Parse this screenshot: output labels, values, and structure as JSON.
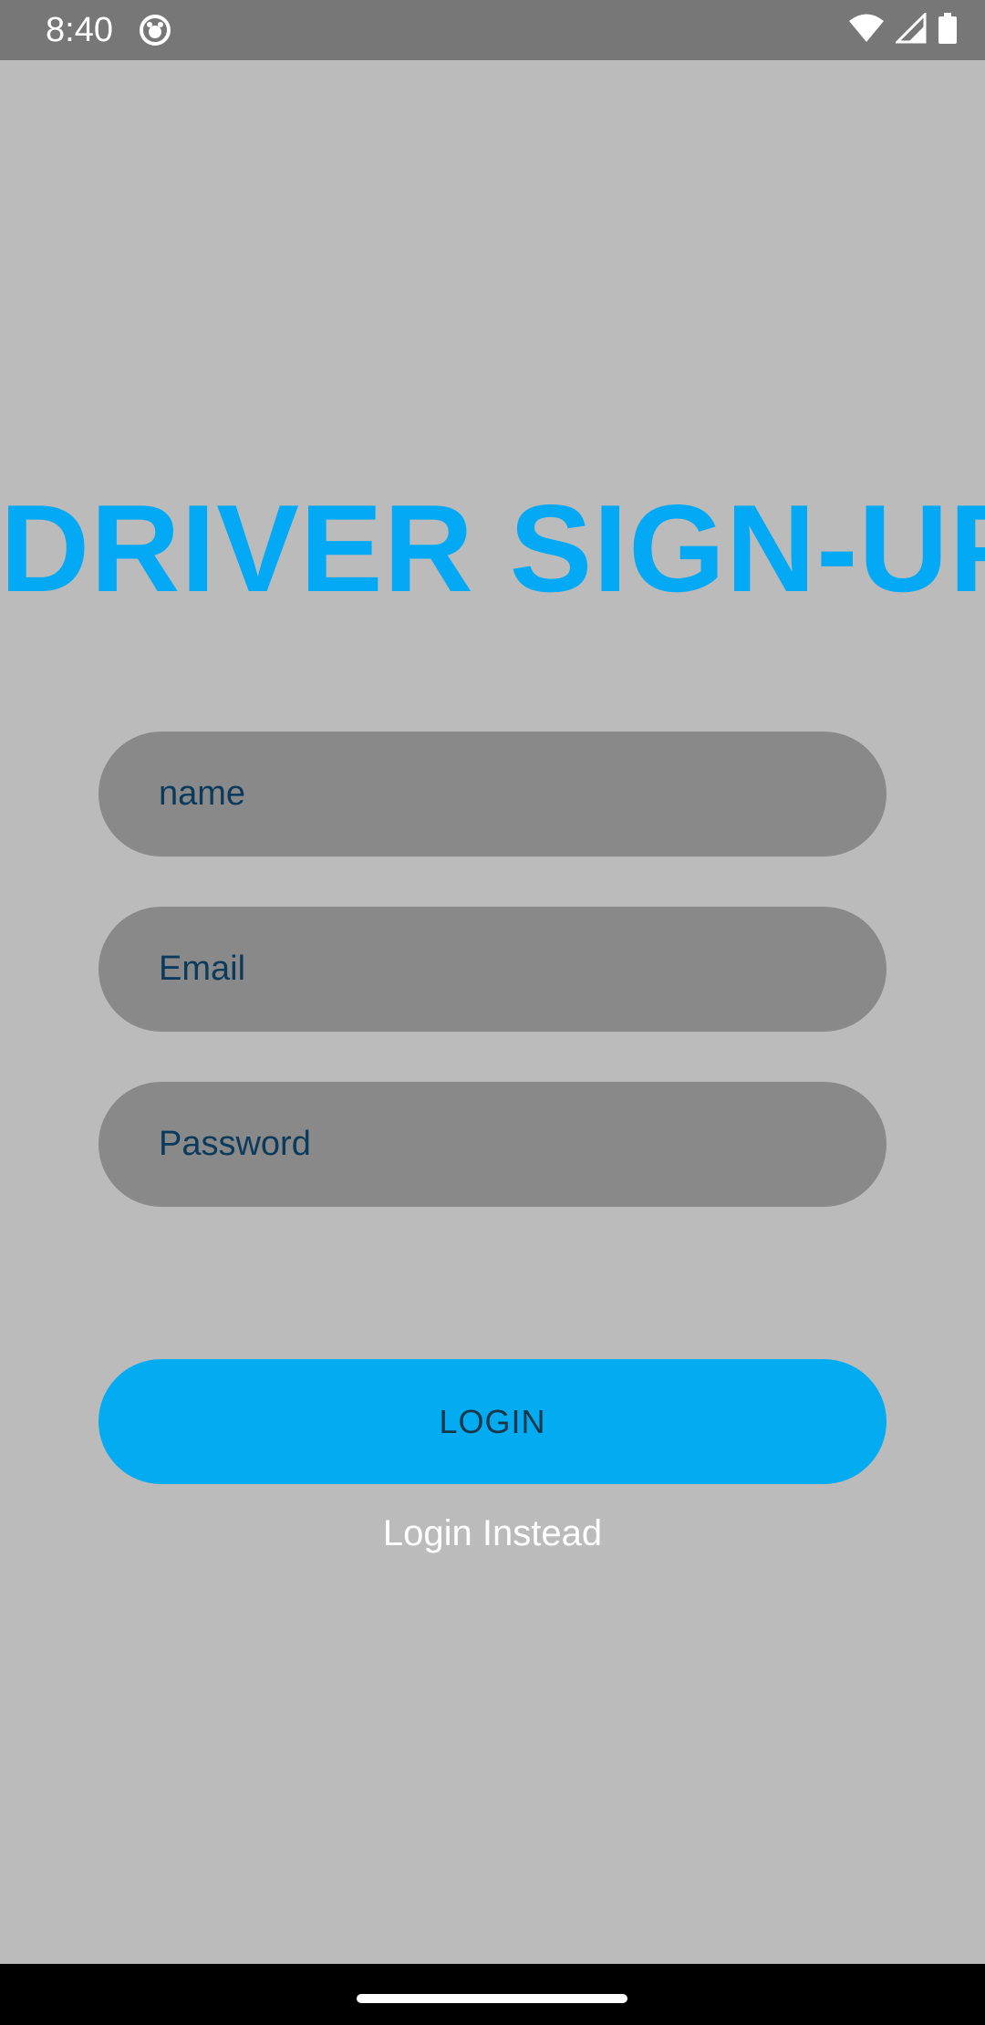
{
  "status_bar": {
    "time": "8:40",
    "icons": [
      "app-notification-icon",
      "wifi-icon",
      "signal-icon",
      "battery-icon"
    ]
  },
  "screen": {
    "title": "DRIVER SIGN-UP",
    "fields": {
      "name_placeholder": "name",
      "email_placeholder": "Email",
      "password_placeholder": "Password"
    },
    "login_button_label": "LOGIN",
    "login_instead_link": "Login Instead"
  },
  "colors": {
    "accent": "#03a9f4",
    "background": "#bbbbbb",
    "field_background": "#898989",
    "status_bar": "#777777"
  }
}
